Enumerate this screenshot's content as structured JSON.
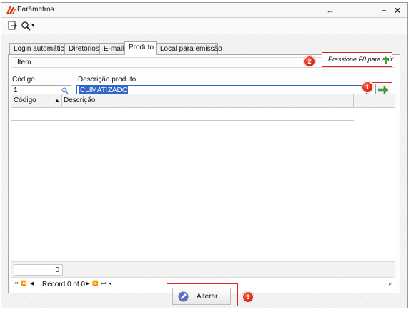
{
  "window": {
    "title": "Parâmetros",
    "restore_symbol": "↔",
    "minimize_symbol": "–",
    "close_symbol": "×"
  },
  "toolbar": {
    "exit_icon": "exit-icon",
    "search_icon": "search-dropdown-icon",
    "dropdown_caret": "▾"
  },
  "tabs": [
    {
      "label": "Login automático",
      "active": false
    },
    {
      "label": "Diretórios",
      "active": false
    },
    {
      "label": "E-mail",
      "active": false
    },
    {
      "label": "Produto",
      "active": true
    },
    {
      "label": "Local para emissão",
      "active": false
    }
  ],
  "group": {
    "title": "Item"
  },
  "hint": {
    "text": "Pressione F8 para sair"
  },
  "fields": {
    "code_label": "Código",
    "code_value": "1",
    "desc_label": "Descrição produto",
    "desc_value": "CLIMATIZADO"
  },
  "grid": {
    "columns": [
      "Código",
      "Descrição"
    ],
    "sort_indicator": "▲",
    "count": "0",
    "navigator": [
      "⏮",
      "⏪",
      "◀"
    ],
    "record_text": "Record 0 of 0",
    "navigator_after": [
      "▶",
      "⏩",
      "⏭",
      "◂"
    ],
    "scroll_right": "▸"
  },
  "actions": {
    "alter_label": "Alterar"
  },
  "badges": {
    "one": "1",
    "two": "2",
    "three": "3"
  },
  "colors": {
    "highlight": "#dd2222",
    "accent_green": "#3ea43e",
    "selection": "#3167c9"
  }
}
